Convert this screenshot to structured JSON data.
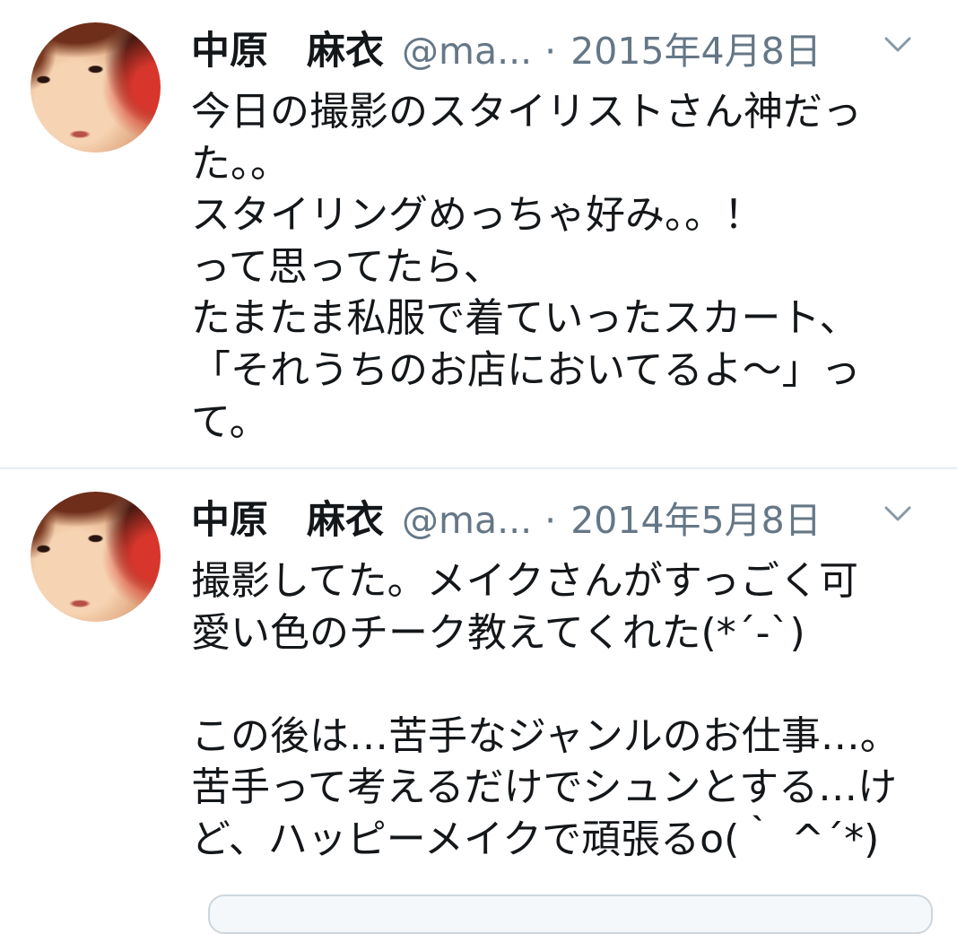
{
  "colors": {
    "text": "#14171a",
    "secondary": "#657786",
    "divider": "#e6ecf0",
    "icon": "#8899a6"
  },
  "menu_icon": "chevron-down-icon",
  "tweets": [
    {
      "author": {
        "name": "中原　麻衣",
        "handle": "@ma..."
      },
      "separator": "·",
      "date": "2015年4月8日",
      "lines": [
        "今日の撮影のスタイリストさん神だっ",
        "た。。",
        "スタイリングめっちゃ好み。。！",
        "って思ってたら、",
        "たまたま私服で着ていったスカート、",
        "「それうちのお店においてるよ〜」っ",
        "て。"
      ]
    },
    {
      "author": {
        "name": "中原　麻衣",
        "handle": "@ma..."
      },
      "separator": "·",
      "date": "2014年5月8日",
      "lines": [
        "撮影してた。メイクさんがすっごく可",
        "愛い色のチーク教えてくれた(*´-`)",
        "",
        "この後は…苦手なジャンルのお仕事…。",
        "苦手って考えるだけでシュンとする…け",
        "ど、ハッピーメイクで頑張るo(｀ ^´*)"
      ]
    }
  ]
}
